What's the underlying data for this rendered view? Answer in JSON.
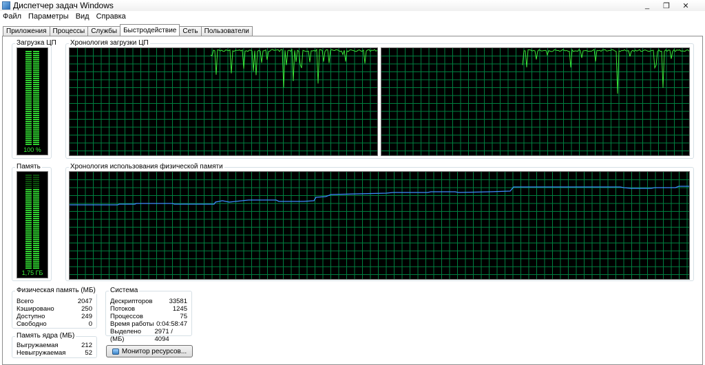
{
  "window": {
    "title": "Диспетчер задач Windows",
    "controls": [
      "_",
      "❐",
      "✕"
    ]
  },
  "menu": [
    "Файл",
    "Параметры",
    "Вид",
    "Справка"
  ],
  "tabs": [
    {
      "label": "Приложения",
      "active": false
    },
    {
      "label": "Процессы",
      "active": false
    },
    {
      "label": "Службы",
      "active": false
    },
    {
      "label": "Быстродействие",
      "active": true
    },
    {
      "label": "Сеть",
      "active": false
    },
    {
      "label": "Пользователи",
      "active": false
    }
  ],
  "cpu": {
    "usage_title": "Загрузка ЦП",
    "usage_value": "100 %",
    "usage_fraction": 1.0,
    "history_title": "Хронология загрузки ЦП"
  },
  "memory": {
    "usage_title": "Память",
    "usage_value": "1,75 ГБ",
    "usage_fraction": 0.86,
    "history_title": "Хронология использования физической памяти"
  },
  "physical_memory": {
    "title": "Физическая память (МБ)",
    "rows": [
      {
        "label": "Всего",
        "value": "2047"
      },
      {
        "label": "Кэшировано",
        "value": "250"
      },
      {
        "label": "Доступно",
        "value": "249"
      },
      {
        "label": "Свободно",
        "value": "0"
      }
    ]
  },
  "kernel_memory": {
    "title": "Память ядра (МБ)",
    "rows": [
      {
        "label": "Выгружаемая",
        "value": "212"
      },
      {
        "label": "Невыгружаемая",
        "value": "52"
      }
    ]
  },
  "system": {
    "title": "Система",
    "rows": [
      {
        "label": "Дескрипторов",
        "value": "33581"
      },
      {
        "label": "Потоков",
        "value": "1245"
      },
      {
        "label": "Процессов",
        "value": "75"
      },
      {
        "label": "Время работы",
        "value": "0:04:58:47"
      },
      {
        "label": "Выделено (МБ)",
        "value": "2971 / 4094"
      }
    ]
  },
  "resource_monitor_button": "Монитор ресурсов...",
  "colors": {
    "graph_bg": "#000000",
    "grid": "#008040",
    "cpu_line": "#39e639",
    "mem_line": "#3d8cff",
    "meter_on": "#2fd12f",
    "meter_off": "#0b4d0b"
  }
}
